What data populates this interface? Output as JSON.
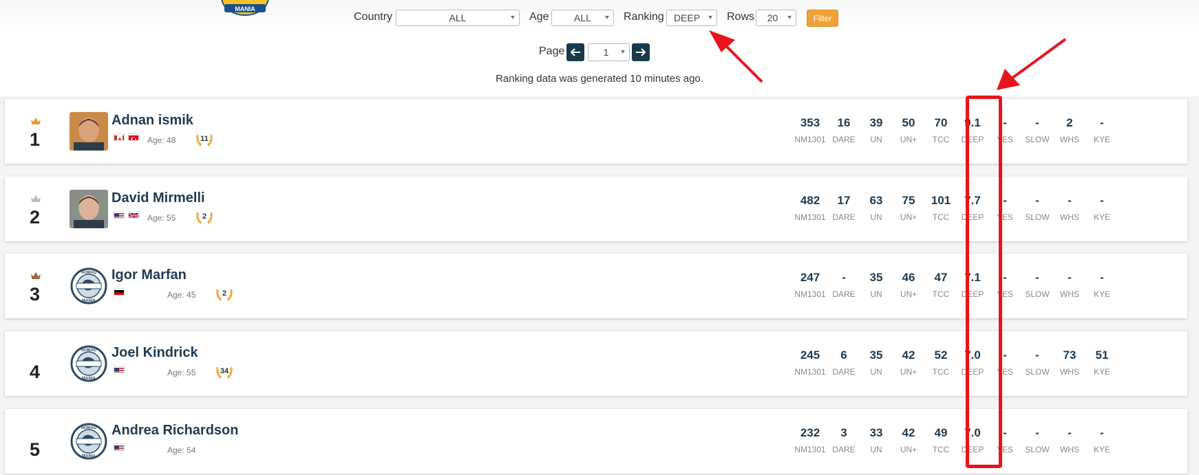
{
  "filters": {
    "country_label": "Country",
    "country_value": "ALL",
    "age_label": "Age",
    "age_value": "ALL",
    "ranking_label": "Ranking",
    "ranking_value": "DEEP",
    "rows_label": "Rows",
    "rows_value": "20",
    "filter_button": "Filter"
  },
  "pager": {
    "label": "Page",
    "page_value": "1"
  },
  "generated_note": "Ranking data was generated 10 minutes ago.",
  "stat_labels": [
    "NM1301",
    "DARE",
    "UN",
    "UN+",
    "TCC",
    "DEEP",
    "YES",
    "SLOW",
    "WHS",
    "KYE"
  ],
  "players": [
    {
      "rank": "1",
      "crown": "gold",
      "name": "Adnan ismik",
      "age": "Age: 48",
      "laurel": "11",
      "flags": [
        "ca",
        "tr"
      ],
      "avatar": "photo",
      "stats": [
        "353",
        "16",
        "39",
        "50",
        "70",
        "9.1",
        "-",
        "-",
        "2",
        "-"
      ]
    },
    {
      "rank": "2",
      "crown": "silver",
      "name": "David Mirmelli",
      "age": "Age: 55",
      "laurel": "2",
      "flags": [
        "us",
        "gb"
      ],
      "avatar": "photo",
      "stats": [
        "482",
        "17",
        "63",
        "75",
        "101",
        "7.7",
        "-",
        "-",
        "-",
        "-"
      ]
    },
    {
      "rank": "3",
      "crown": "bronze",
      "name": "Igor Marfan",
      "age": "Age: 45",
      "laurel": "2",
      "flags": [
        "de"
      ],
      "avatar": "logo",
      "stats": [
        "247",
        "-",
        "35",
        "46",
        "47",
        "7.1",
        "-",
        "-",
        "-",
        "-"
      ]
    },
    {
      "rank": "4",
      "crown": "",
      "name": "Joel Kindrick",
      "age": "Age: 55",
      "laurel": "34",
      "flags": [
        "us"
      ],
      "avatar": "logo",
      "stats": [
        "245",
        "6",
        "35",
        "42",
        "52",
        "7.0",
        "-",
        "-",
        "73",
        "51"
      ]
    },
    {
      "rank": "5",
      "crown": "",
      "name": "Andrea Richardson",
      "age": "Age: 54",
      "laurel": "",
      "flags": [
        "us"
      ],
      "avatar": "logo",
      "stats": [
        "232",
        "3",
        "33",
        "42",
        "49",
        "7.0",
        "-",
        "-",
        "-",
        "-"
      ]
    }
  ],
  "colors": {
    "highlight": "#e8141b",
    "filter_button": "#f0a23a",
    "pager_button": "#163a4c",
    "name": "#1e3b52",
    "crown_gold": "#e0a030",
    "crown_silver": "#b9bcc2",
    "crown_bronze": "#9b6a3a"
  }
}
